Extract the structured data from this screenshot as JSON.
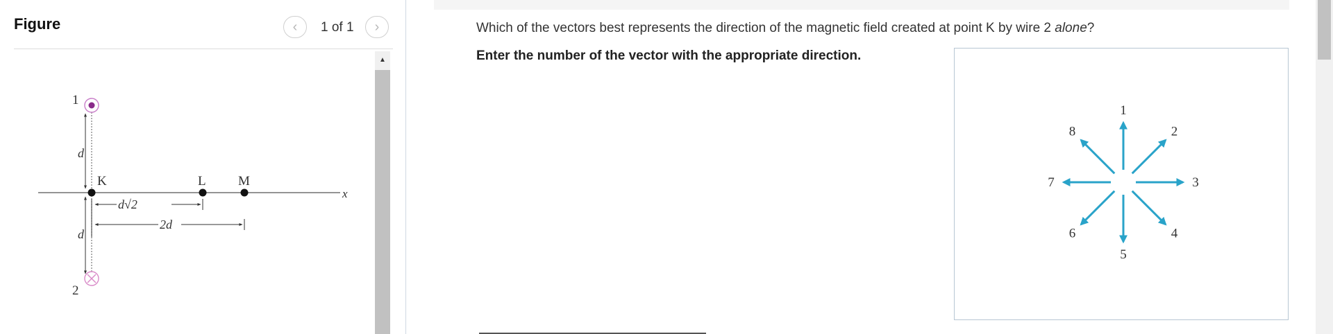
{
  "figure_panel": {
    "title": "Figure",
    "pager_text": "1 of 1",
    "prev_icon": "‹",
    "next_icon": "›",
    "scroll_up_icon": "▲",
    "diagram": {
      "wire1_label": "1",
      "wire2_label": "2",
      "d_top": "d",
      "d_bottom": "d",
      "point_K": "K",
      "point_L": "L",
      "point_M": "M",
      "x_axis": "x",
      "dist_L": "d√2",
      "dist_M": "2d"
    }
  },
  "question_panel": {
    "question_prefix": "Which of the vectors best represents the direction of the magnetic field created at point K by wire 2 ",
    "question_emph": "alone",
    "question_suffix": "?",
    "instruction": "Enter the number of the vector with the appropriate direction.",
    "vector_labels": [
      "1",
      "2",
      "3",
      "4",
      "5",
      "6",
      "7",
      "8"
    ],
    "vector_color": "#29a3c9"
  },
  "colors": {
    "wire_out": "#8a2a8a",
    "wire_in": "#d98ac8"
  }
}
